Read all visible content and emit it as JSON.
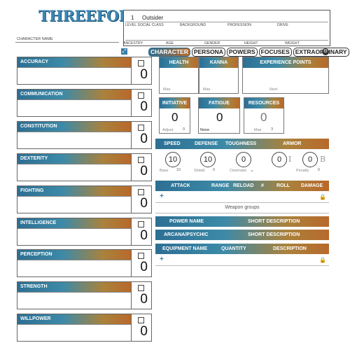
{
  "header": {
    "logo": "THREEFOLD",
    "character_name_label": "CHARACTER NAME",
    "level_value": "1",
    "social_class_value": "Outsider",
    "labels": {
      "level_social": "LEVEL  SOCIAL CLASS",
      "background": "BACKGROUND",
      "profession": "PROFESSION",
      "drive": "DRIVE",
      "ancestry": "ANCESTRY",
      "age": "AGE",
      "gender": "GENDER",
      "height": "HEIGHT",
      "weight": "WEIGHT"
    }
  },
  "tabs": [
    "CHARACTER",
    "PERSONA",
    "POWERS",
    "FOCUSES",
    "EXTRAORDINARY"
  ],
  "attributes": [
    {
      "name": "ACCURACY",
      "value": "0"
    },
    {
      "name": "COMMUNICATION",
      "value": "0"
    },
    {
      "name": "CONSTITUTION",
      "value": "0"
    },
    {
      "name": "DEXTERITY",
      "value": "0"
    },
    {
      "name": "FIGHTING",
      "value": "0"
    },
    {
      "name": "INTELLIGENCE",
      "value": "0"
    },
    {
      "name": "PERCEPTION",
      "value": "0"
    },
    {
      "name": "STRENGTH",
      "value": "0"
    },
    {
      "name": "WILLPOWER",
      "value": "0"
    }
  ],
  "health": {
    "label": "HEALTH",
    "max_label": "Max"
  },
  "kanna": {
    "label": "KANNA",
    "max_label": "Max"
  },
  "experience": {
    "label": "EXPERIENCE POINTS",
    "next_label": "Next"
  },
  "initiative": {
    "label": "INITIATIVE",
    "value": "0",
    "adjust_label": "Adjust",
    "adjust_value": "0"
  },
  "fatigue": {
    "label": "FATIGUE",
    "value": "0",
    "status": "None"
  },
  "resources": {
    "label": "RESOURCES",
    "value": "0",
    "max_label": "Max",
    "max_value": "3"
  },
  "combat": {
    "headers": [
      "SPEED",
      "DEFENSE",
      "TOUGHNESS",
      "ARMOR"
    ],
    "speed": "10",
    "defense": "10",
    "toughness": "0",
    "armor_i": "0",
    "armor_b": "0",
    "armor_i_label": "I",
    "armor_b_label": "B",
    "base_label": "Base",
    "base_value": "10",
    "shield_label": "Shield",
    "shield_value": "0",
    "cinematic_label": "Cinematic",
    "penalty_label": "Penalty",
    "penalty_value": "0"
  },
  "attack_table": {
    "headers": [
      "ATTACK",
      "RANGE",
      "RELOAD",
      "#",
      "ROLL",
      "DAMAGE"
    ],
    "add": "+",
    "lock": "🔒",
    "footer": "Weapon groups"
  },
  "powers_table": {
    "headers": [
      "POWER NAME",
      "SHORT DESCRIPTION"
    ]
  },
  "arcana_table": {
    "headers": [
      "ARCANA/PSYCHIC",
      "SHORT DESCRIPTION"
    ]
  },
  "equipment_table": {
    "headers": [
      "EQUIPMENT NAME",
      "QUANTITY",
      "DESCRIPTION"
    ],
    "add": "+",
    "lock": "🔒"
  }
}
